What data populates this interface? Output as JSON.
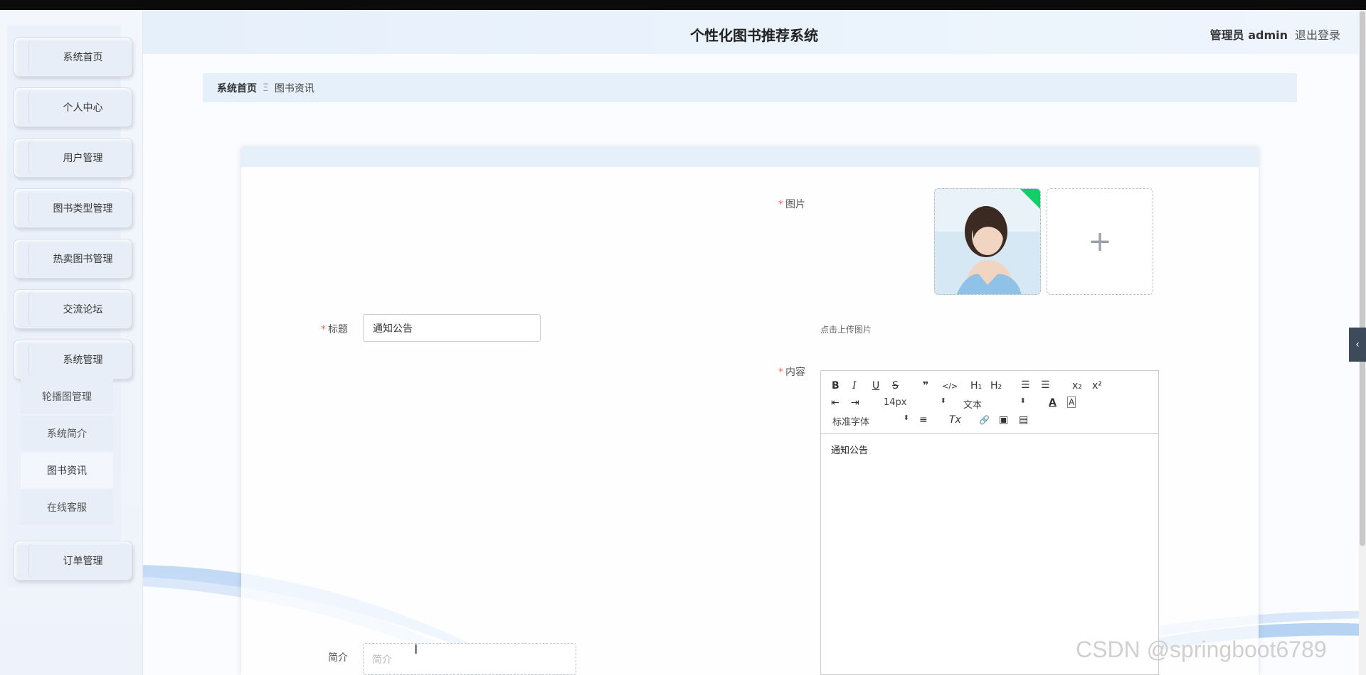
{
  "header": {
    "title": "个性化图书推荐系统",
    "user": "管理员 admin",
    "logout": "退出登录"
  },
  "sidebar": {
    "items": [
      {
        "label": "系统首页"
      },
      {
        "label": "个人中心"
      },
      {
        "label": "用户管理"
      },
      {
        "label": "图书类型管理"
      },
      {
        "label": "热卖图书管理"
      },
      {
        "label": "交流论坛"
      },
      {
        "label": "系统管理"
      },
      {
        "label": "订单管理"
      }
    ],
    "subitems": [
      {
        "label": "轮播图管理"
      },
      {
        "label": "系统简介"
      },
      {
        "label": "图书资讯",
        "active": true
      },
      {
        "label": "在线客服"
      }
    ]
  },
  "breadcrumb": {
    "home": "系统首页",
    "separator": "Ξ",
    "current": "图书资讯"
  },
  "form": {
    "title_label": "标题",
    "title_value": "通知公告",
    "image_label": "图片",
    "upload_hint": "点击上传图片",
    "content_label": "内容",
    "intro_label": "简介",
    "intro_placeholder": "简介",
    "required_mark": "*"
  },
  "editor": {
    "font_size": "14px",
    "paragraph": "文本",
    "font_family": "标准字体",
    "content": "通知公告",
    "buttons": {
      "bold": "B",
      "italic": "I",
      "underline": "U",
      "strike": "S",
      "quote": "❞",
      "code": "</>",
      "h1": "H₁",
      "h2": "H₂",
      "ordered_list": "☰",
      "bullet_list": "☰",
      "subscript": "x₂",
      "superscript": "x²",
      "indent_dec": "⇤",
      "indent_inc": "⇥",
      "color": "A",
      "background": "A",
      "align": "≡",
      "clean": "Tx",
      "link": "🔗",
      "image": "▣",
      "video": "▤"
    }
  },
  "watermark": "CSDN @springboot6789",
  "icons": {
    "collapse": "chevron-left-icon",
    "upload": "plus-icon"
  },
  "colors": {
    "accent": "#e6f0fb",
    "required": "#f56c6c",
    "upload_success": "#13ce66"
  }
}
